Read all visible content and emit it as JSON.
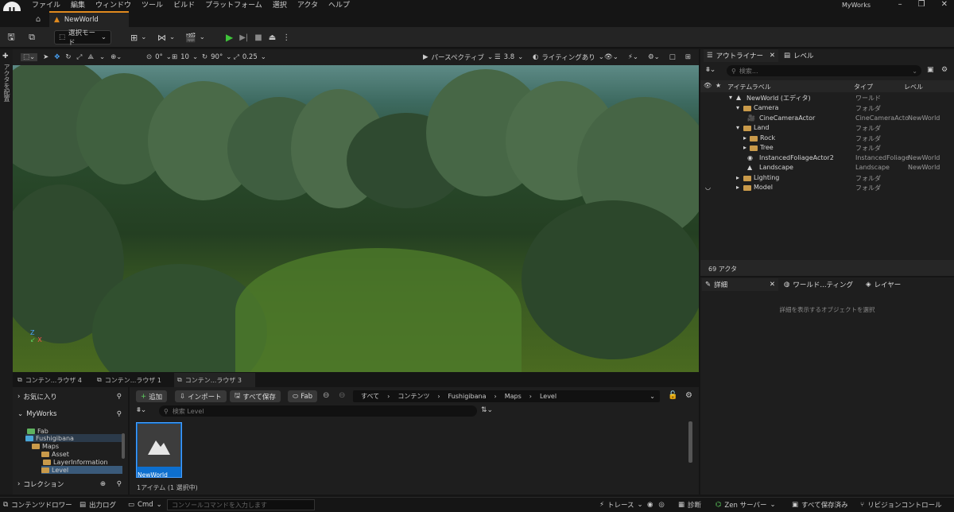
{
  "menubar": {
    "items": [
      "ファイル",
      "編集",
      "ウィンドウ",
      "ツール",
      "ビルド",
      "プラットフォーム",
      "選択",
      "アクタ",
      "ヘルプ"
    ],
    "project_name": "MyWorks"
  },
  "tabs": {
    "level_tab": "NewWorld"
  },
  "toolbar": {
    "mode_select": "選択モード"
  },
  "left_strip": {
    "label": "アクタを配置"
  },
  "viewport_toolbar": {
    "grid_snap": "0°",
    "location_snap": "10",
    "rotation_snap": "90°",
    "scale_snap": "0.25",
    "view_mode": "パースペクティブ",
    "camera_speed": "3.8",
    "lighting": "ライティングあり"
  },
  "content_browser": {
    "tabs": [
      "コンテン...ラウザ 4",
      "コンテン...ラウザ 1",
      "コンテン...ラウザ 3"
    ],
    "favorites": "お気に入り",
    "project": "MyWorks",
    "folders": [
      "Fab",
      "Fushigibana",
      "Maps",
      "Asset",
      "LayerInformation",
      "Level"
    ],
    "collections": "コレクション",
    "add_button": "追加",
    "import_button": "インポート",
    "save_all_button": "すべて保存",
    "fab_button": "Fab",
    "path": [
      "すべて",
      "コンテンツ",
      "Fushigibana",
      "Maps",
      "Level"
    ],
    "search_placeholder": "検索 Level",
    "asset_name": "NewWorld",
    "item_count": "1アイテム (1 選択中)"
  },
  "outliner": {
    "tab_label": "アウトライナー",
    "levels_tab": "レベル",
    "search_placeholder": "検索...",
    "col_label": "アイテムラベル",
    "col_type": "タイプ",
    "col_level": "レベル",
    "rows": [
      {
        "label": "NewWorld (エディタ)",
        "type": "ワールド",
        "level": ""
      },
      {
        "label": "Camera",
        "type": "フォルダ",
        "level": ""
      },
      {
        "label": "CineCameraActor",
        "type": "CineCameraActo",
        "level": "NewWorld"
      },
      {
        "label": "Land",
        "type": "フォルダ",
        "level": ""
      },
      {
        "label": "Rock",
        "type": "フォルダ",
        "level": ""
      },
      {
        "label": "Tree",
        "type": "フォルダ",
        "level": ""
      },
      {
        "label": "InstancedFoliageActor2",
        "type": "InstancedFoliage",
        "level": "NewWorld"
      },
      {
        "label": "Landscape",
        "type": "Landscape",
        "level": "NewWorld"
      },
      {
        "label": "Lighting",
        "type": "フォルダ",
        "level": ""
      },
      {
        "label": "Model",
        "type": "フォルダ",
        "level": ""
      }
    ],
    "actor_count": "69 アクタ"
  },
  "details": {
    "tab_label": "詳細",
    "world_settings_tab": "ワールド...ティング",
    "layers_tab": "レイヤー",
    "empty_message": "詳細を表示するオブジェクトを選択"
  },
  "statusbar": {
    "content_drawer": "コンテンツドロワー",
    "output_log": "出力ログ",
    "cmd": "Cmd",
    "console_placeholder": "コンソールコマンドを入力します",
    "trace": "トレース",
    "diagnostics": "診断",
    "zen_server": "Zen サーバー",
    "all_saved": "すべて保存済み",
    "revision_control": "リビジョンコントロール"
  }
}
